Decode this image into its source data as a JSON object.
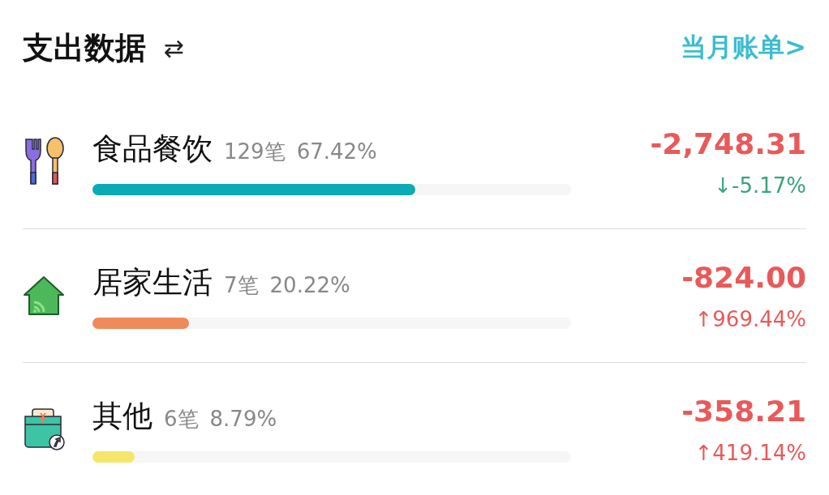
{
  "header": {
    "title": "支出数据",
    "switch_icon": "⇄",
    "link": "当月账单>"
  },
  "categories": [
    {
      "kind": "utensils",
      "name": "食品餐饮",
      "count": "129笔",
      "share": "67.42%",
      "level": 0.6742,
      "color": "#0aabb5",
      "amount": "-2,748.31",
      "change": {
        "kind": "down",
        "text": "↓-5.17%"
      }
    },
    {
      "kind": "house",
      "name": "居家生活",
      "count": "7笔",
      "share": "20.22%",
      "level": 0.2022,
      "color": "#ef8a5b",
      "amount": "-824.00",
      "change": {
        "kind": "up",
        "text": "↑969.44%"
      }
    },
    {
      "kind": "wallet",
      "name": "其他",
      "count": "6笔",
      "share": "8.79%",
      "level": 0.0879,
      "color": "#f5e66a",
      "amount": "-358.21",
      "change": {
        "kind": "up",
        "text": "↑419.14%"
      }
    }
  ]
}
